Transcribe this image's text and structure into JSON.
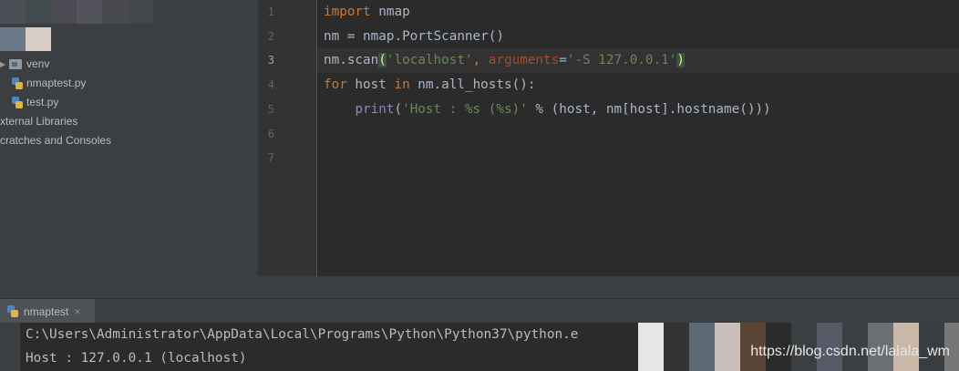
{
  "sidebar": {
    "items": [
      {
        "label": "venv",
        "icon": "folder-icon"
      },
      {
        "label": "nmaptest.py",
        "icon": "python-file-icon"
      },
      {
        "label": "test.py",
        "icon": "python-file-icon"
      },
      {
        "label": "xternal Libraries",
        "icon": ""
      },
      {
        "label": "cratches and Consoles",
        "icon": ""
      }
    ]
  },
  "editor": {
    "line_numbers": [
      "1",
      "2",
      "3",
      "4",
      "5",
      "6",
      "7"
    ],
    "current_line": 3,
    "code": {
      "l1_kw": "import",
      "l1_rest": " nmap",
      "l2": "nm = nmap.PortScanner()",
      "l3_a": "nm.scan",
      "l3_open": "(",
      "l3_str1": "'localhost'",
      "l3_comma": ", ",
      "l3_param": "arguments",
      "l3_eq": "=",
      "l3_str2": "'-S 127.0.0.1'",
      "l3_close": ")",
      "l4_kw1": "for",
      "l4_a": " host ",
      "l4_kw2": "in",
      "l4_b": " nm.all_hosts():",
      "l5_indent": "    ",
      "l5_print": "print",
      "l5_open": "(",
      "l5_str": "'Host : %s (%s)'",
      "l5_rest": " % (host, nm[host].hostname()))"
    }
  },
  "run_panel": {
    "tab_label": "nmaptest",
    "tab_close": "×",
    "console_lines": [
      "C:\\Users\\Administrator\\AppData\\Local\\Programs\\Python\\Python37\\python.e",
      "Host : 127.0.0.1 (localhost)"
    ],
    "watermark": "https://blog.csdn.net/lalala_wm"
  },
  "colors": {
    "keyword": "#cc7832",
    "string": "#6a8759",
    "param": "#aa4926",
    "builtin": "#8888c6"
  }
}
